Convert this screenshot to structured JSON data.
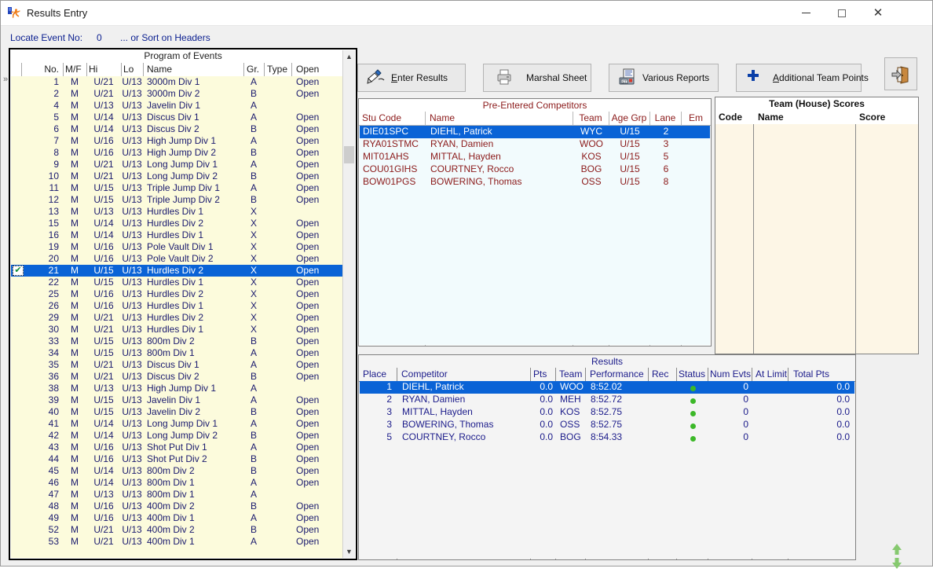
{
  "window": {
    "title": "Results Entry",
    "app_icon": "runner-icon",
    "controls": {
      "minimize": "minimize-icon",
      "maximize": "maximize-icon",
      "close": "close-icon"
    }
  },
  "locate": {
    "label": "Locate Event No:",
    "value": "0",
    "hint": "... or Sort on Headers"
  },
  "toolbar": {
    "enter_results": "Enter Results",
    "marshal_sheet": "Marshal Sheet",
    "various_reports": "Various Reports",
    "additional_team_points": "Additional Team Points",
    "exit": "exit-door-icon"
  },
  "events": {
    "caption": "Program of Events",
    "columns": [
      "No.",
      "M/F",
      "Hi",
      "Lo",
      "Name",
      "Gr.",
      "Type",
      "Open"
    ],
    "selected_row_index": 16,
    "rows": [
      {
        "no": "1",
        "mf": "M",
        "hi": "U/21",
        "lo": "U/13",
        "name": "3000m Div 1",
        "gr": "A",
        "type": "",
        "open": "Open"
      },
      {
        "no": "2",
        "mf": "M",
        "hi": "U/21",
        "lo": "U/13",
        "name": "3000m Div 2",
        "gr": "B",
        "type": "",
        "open": "Open"
      },
      {
        "no": "4",
        "mf": "M",
        "hi": "U/13",
        "lo": "U/13",
        "name": "Javelin Div 1",
        "gr": "A",
        "type": "",
        "open": ""
      },
      {
        "no": "5",
        "mf": "M",
        "hi": "U/14",
        "lo": "U/13",
        "name": "Discus Div 1",
        "gr": "A",
        "type": "",
        "open": "Open"
      },
      {
        "no": "6",
        "mf": "M",
        "hi": "U/14",
        "lo": "U/13",
        "name": "Discus Div 2",
        "gr": "B",
        "type": "",
        "open": "Open"
      },
      {
        "no": "7",
        "mf": "M",
        "hi": "U/16",
        "lo": "U/13",
        "name": "High Jump Div 1",
        "gr": "A",
        "type": "",
        "open": "Open"
      },
      {
        "no": "8",
        "mf": "M",
        "hi": "U/16",
        "lo": "U/13",
        "name": "High Jump Div 2",
        "gr": "B",
        "type": "",
        "open": "Open"
      },
      {
        "no": "9",
        "mf": "M",
        "hi": "U/21",
        "lo": "U/13",
        "name": "Long Jump Div 1",
        "gr": "A",
        "type": "",
        "open": "Open"
      },
      {
        "no": "10",
        "mf": "M",
        "hi": "U/21",
        "lo": "U/13",
        "name": "Long Jump Div 2",
        "gr": "B",
        "type": "",
        "open": "Open"
      },
      {
        "no": "11",
        "mf": "M",
        "hi": "U/15",
        "lo": "U/13",
        "name": "Triple Jump Div 1",
        "gr": "A",
        "type": "",
        "open": "Open"
      },
      {
        "no": "12",
        "mf": "M",
        "hi": "U/15",
        "lo": "U/13",
        "name": "Triple Jump Div 2",
        "gr": "B",
        "type": "",
        "open": "Open"
      },
      {
        "no": "13",
        "mf": "M",
        "hi": "U/13",
        "lo": "U/13",
        "name": "Hurdles Div 1",
        "gr": "X",
        "type": "",
        "open": ""
      },
      {
        "no": "15",
        "mf": "M",
        "hi": "U/14",
        "lo": "U/13",
        "name": "Hurdles Div 2",
        "gr": "X",
        "type": "",
        "open": "Open"
      },
      {
        "no": "16",
        "mf": "M",
        "hi": "U/14",
        "lo": "U/13",
        "name": "Hurdles Div 1",
        "gr": "X",
        "type": "",
        "open": "Open"
      },
      {
        "no": "19",
        "mf": "M",
        "hi": "U/16",
        "lo": "U/13",
        "name": "Pole Vault Div 1",
        "gr": "X",
        "type": "",
        "open": "Open"
      },
      {
        "no": "20",
        "mf": "M",
        "hi": "U/16",
        "lo": "U/13",
        "name": "Pole Vault Div 2",
        "gr": "X",
        "type": "",
        "open": "Open"
      },
      {
        "no": "21",
        "mf": "M",
        "hi": "U/15",
        "lo": "U/13",
        "name": "Hurdles Div 2",
        "gr": "X",
        "type": "",
        "open": "Open"
      },
      {
        "no": "22",
        "mf": "M",
        "hi": "U/15",
        "lo": "U/13",
        "name": "Hurdles Div 1",
        "gr": "X",
        "type": "",
        "open": "Open"
      },
      {
        "no": "25",
        "mf": "M",
        "hi": "U/16",
        "lo": "U/13",
        "name": "Hurdles Div 2",
        "gr": "X",
        "type": "",
        "open": "Open"
      },
      {
        "no": "26",
        "mf": "M",
        "hi": "U/16",
        "lo": "U/13",
        "name": "Hurdles Div 1",
        "gr": "X",
        "type": "",
        "open": "Open"
      },
      {
        "no": "29",
        "mf": "M",
        "hi": "U/21",
        "lo": "U/13",
        "name": "Hurdles Div 2",
        "gr": "X",
        "type": "",
        "open": "Open"
      },
      {
        "no": "30",
        "mf": "M",
        "hi": "U/21",
        "lo": "U/13",
        "name": "Hurdles Div 1",
        "gr": "X",
        "type": "",
        "open": "Open"
      },
      {
        "no": "33",
        "mf": "M",
        "hi": "U/15",
        "lo": "U/13",
        "name": "800m Div 2",
        "gr": "B",
        "type": "",
        "open": "Open"
      },
      {
        "no": "34",
        "mf": "M",
        "hi": "U/15",
        "lo": "U/13",
        "name": "800m Div 1",
        "gr": "A",
        "type": "",
        "open": "Open"
      },
      {
        "no": "35",
        "mf": "M",
        "hi": "U/21",
        "lo": "U/13",
        "name": "Discus Div 1",
        "gr": "A",
        "type": "",
        "open": "Open"
      },
      {
        "no": "36",
        "mf": "M",
        "hi": "U/21",
        "lo": "U/13",
        "name": "Discus Div 2",
        "gr": "B",
        "type": "",
        "open": "Open"
      },
      {
        "no": "38",
        "mf": "M",
        "hi": "U/13",
        "lo": "U/13",
        "name": "High Jump Div 1",
        "gr": "A",
        "type": "",
        "open": ""
      },
      {
        "no": "39",
        "mf": "M",
        "hi": "U/15",
        "lo": "U/13",
        "name": "Javelin Div 1",
        "gr": "A",
        "type": "",
        "open": "Open"
      },
      {
        "no": "40",
        "mf": "M",
        "hi": "U/15",
        "lo": "U/13",
        "name": "Javelin Div 2",
        "gr": "B",
        "type": "",
        "open": "Open"
      },
      {
        "no": "41",
        "mf": "M",
        "hi": "U/14",
        "lo": "U/13",
        "name": "Long Jump Div 1",
        "gr": "A",
        "type": "",
        "open": "Open"
      },
      {
        "no": "42",
        "mf": "M",
        "hi": "U/14",
        "lo": "U/13",
        "name": "Long Jump Div 2",
        "gr": "B",
        "type": "",
        "open": "Open"
      },
      {
        "no": "43",
        "mf": "M",
        "hi": "U/16",
        "lo": "U/13",
        "name": "Shot Put Div 1",
        "gr": "A",
        "type": "",
        "open": "Open"
      },
      {
        "no": "44",
        "mf": "M",
        "hi": "U/16",
        "lo": "U/13",
        "name": "Shot Put Div 2",
        "gr": "B",
        "type": "",
        "open": "Open"
      },
      {
        "no": "45",
        "mf": "M",
        "hi": "U/14",
        "lo": "U/13",
        "name": "800m Div 2",
        "gr": "B",
        "type": "",
        "open": "Open"
      },
      {
        "no": "46",
        "mf": "M",
        "hi": "U/14",
        "lo": "U/13",
        "name": "800m Div 1",
        "gr": "A",
        "type": "",
        "open": "Open"
      },
      {
        "no": "47",
        "mf": "M",
        "hi": "U/13",
        "lo": "U/13",
        "name": "800m Div 1",
        "gr": "A",
        "type": "",
        "open": ""
      },
      {
        "no": "48",
        "mf": "M",
        "hi": "U/16",
        "lo": "U/13",
        "name": "400m Div 2",
        "gr": "B",
        "type": "",
        "open": "Open"
      },
      {
        "no": "49",
        "mf": "M",
        "hi": "U/16",
        "lo": "U/13",
        "name": "400m Div 1",
        "gr": "A",
        "type": "",
        "open": "Open"
      },
      {
        "no": "52",
        "mf": "M",
        "hi": "U/21",
        "lo": "U/13",
        "name": "400m Div 2",
        "gr": "B",
        "type": "",
        "open": "Open"
      },
      {
        "no": "53",
        "mf": "M",
        "hi": "U/21",
        "lo": "U/13",
        "name": "400m Div 1",
        "gr": "A",
        "type": "",
        "open": "Open"
      }
    ]
  },
  "pre_entered": {
    "caption": "Pre-Entered Competitors",
    "columns": [
      "Stu Code",
      "Name",
      "Team",
      "Age Grp",
      "Lane",
      "Em"
    ],
    "selected_row_index": 0,
    "rows": [
      {
        "stu_code": "DIE01SPC",
        "name": "DIEHL, Patrick",
        "team": "WYC",
        "age_grp": "U/15",
        "lane": "2",
        "em": ""
      },
      {
        "stu_code": "RYA01STMC",
        "name": "RYAN, Damien",
        "team": "WOO",
        "age_grp": "U/15",
        "lane": "3",
        "em": ""
      },
      {
        "stu_code": "MIT01AHS",
        "name": "MITTAL, Hayden",
        "team": "KOS",
        "age_grp": "U/15",
        "lane": "5",
        "em": ""
      },
      {
        "stu_code": "COU01GIHS",
        "name": "COURTNEY, Rocco",
        "team": "BOG",
        "age_grp": "U/15",
        "lane": "6",
        "em": ""
      },
      {
        "stu_code": "BOW01PGS",
        "name": "BOWERING, Thomas",
        "team": "OSS",
        "age_grp": "U/15",
        "lane": "8",
        "em": ""
      }
    ]
  },
  "team_scores": {
    "caption": "Team (House) Scores",
    "columns": [
      "Code",
      "Name",
      "Score"
    ],
    "rows": []
  },
  "results": {
    "caption": "Results",
    "columns": [
      "Place",
      "Competitor",
      "Pts",
      "Team",
      "Performance",
      "Rec",
      "Status",
      "Num Evts",
      "At Limit",
      "Total Pts"
    ],
    "selected_row_index": 0,
    "rows": [
      {
        "place": "1",
        "competitor": "DIEHL, Patrick",
        "pts": "0.0",
        "team": "WOO",
        "performance": "8:52.02",
        "rec": "",
        "status": "green-dot",
        "num_evts": "0",
        "at_limit": "",
        "total_pts": "0.0"
      },
      {
        "place": "2",
        "competitor": "RYAN, Damien",
        "pts": "0.0",
        "team": "MEH",
        "performance": "8:52.72",
        "rec": "",
        "status": "green-dot",
        "num_evts": "0",
        "at_limit": "",
        "total_pts": "0.0"
      },
      {
        "place": "3",
        "competitor": "MITTAL, Hayden",
        "pts": "0.0",
        "team": "KOS",
        "performance": "8:52.75",
        "rec": "",
        "status": "green-dot",
        "num_evts": "0",
        "at_limit": "",
        "total_pts": "0.0"
      },
      {
        "place": "3",
        "competitor": "BOWERING, Thomas",
        "pts": "0.0",
        "team": "OSS",
        "performance": "8:52.75",
        "rec": "",
        "status": "green-dot",
        "num_evts": "0",
        "at_limit": "",
        "total_pts": "0.0"
      },
      {
        "place": "5",
        "competitor": "COURTNEY, Rocco",
        "pts": "0.0",
        "team": "BOG",
        "performance": "8:54.33",
        "rec": "",
        "status": "green-dot",
        "num_evts": "0",
        "at_limit": "",
        "total_pts": "0.0"
      }
    ]
  },
  "colors": {
    "selection": "#0a63d6",
    "events_bg": "#fcfbdc",
    "pre_bg": "#f2fbfd",
    "team_bg": "#fdf6e6",
    "results_bg": "#f4f4f4",
    "events_text": "#1a1a6e",
    "pre_text": "#8b1a1a",
    "results_text": "#1b1b8a",
    "status_dot": "#3cb828"
  }
}
